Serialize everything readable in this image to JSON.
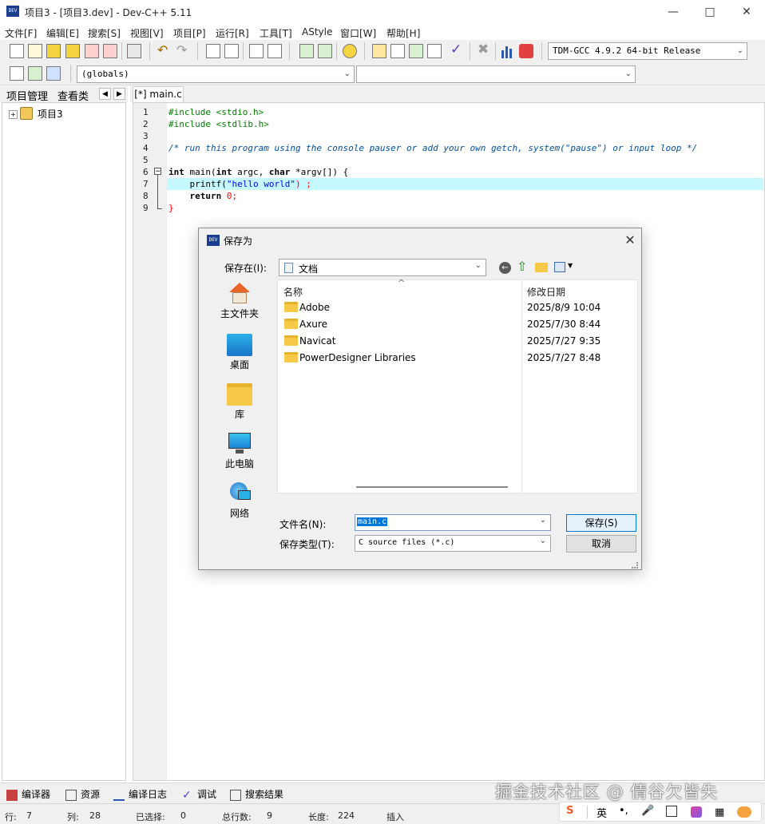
{
  "window": {
    "title": "项目3 - [项目3.dev] - Dev-C++ 5.11",
    "icon_label": "DEV"
  },
  "menu": [
    "文件[F]",
    "编辑[E]",
    "搜索[S]",
    "视图[V]",
    "项目[P]",
    "运行[R]",
    "工具[T]",
    "AStyle",
    "窗口[W]",
    "帮助[H]"
  ],
  "toolbar": {
    "compiler_select": "TDM-GCC 4.9.2 64-bit Release",
    "scope_select": "(globals)",
    "member_select": ""
  },
  "left_panel": {
    "tabs": [
      "项目管理",
      "查看类"
    ],
    "tree_root": "项目3",
    "tree_expander": "+"
  },
  "editor": {
    "tab_label": "[*] main.c",
    "line_numbers": [
      "1",
      "2",
      "3",
      "4",
      "5",
      "6",
      "7",
      "8",
      "9"
    ],
    "fold_marker": "−",
    "lines": {
      "l1": "#include <stdio.h>",
      "l2": "#include <stdlib.h>",
      "l4": "/* run this program using the console pauser or add your own getch, system(\"pause\") or input loop */",
      "l6a": "int",
      "l6b": " main(",
      "l6c": "int",
      "l6d": " argc, ",
      "l6e": "char",
      "l6f": " *argv[]) {",
      "l7a": "    printf(",
      "l7b": "\"hello world\"",
      "l7c": ") ;",
      "l8a": "    ",
      "l8b": "return",
      "l8c": " ",
      "l8d": "0",
      "l8e": ";",
      "l9": "}"
    },
    "highlight_color": "#c6f9ff"
  },
  "dialog": {
    "title": "保存为",
    "save_in_label": "保存在(I):",
    "save_in_value": "文档",
    "places": [
      "主文件夹",
      "桌面",
      "库",
      "此电脑",
      "网络"
    ],
    "columns": {
      "name": "名称",
      "modified": "修改日期"
    },
    "sort_indicator": "^",
    "files": [
      {
        "name": "Adobe",
        "date": "2025/8/9 10:04"
      },
      {
        "name": "Axure",
        "date": "2025/7/30 8:44"
      },
      {
        "name": "Navicat",
        "date": "2025/7/27 9:35"
      },
      {
        "name": "PowerDesigner Libraries",
        "date": "2025/7/27 8:48"
      }
    ],
    "filename_label": "文件名(N):",
    "filename_value": "main.c",
    "filetype_label": "保存类型(T):",
    "filetype_value": "C source files (*.c)",
    "save_button": "保存(S)",
    "cancel_button": "取消"
  },
  "bottom_tabs": [
    "编译器",
    "资源",
    "编译日志",
    "调试",
    "搜索结果"
  ],
  "status": {
    "row_label": "行:",
    "row_value": "7",
    "col_label": "列:",
    "col_value": "28",
    "sel_label": "已选择:",
    "sel_value": "0",
    "total_label": "总行数:",
    "total_value": "9",
    "len_label": "长度:",
    "len_value": "224",
    "mode": "插入"
  },
  "ime": {
    "logo": "S",
    "lang": "英",
    "punct": "•,"
  },
  "watermark": "掘金技术社区 @ 倩谷欠皆失"
}
